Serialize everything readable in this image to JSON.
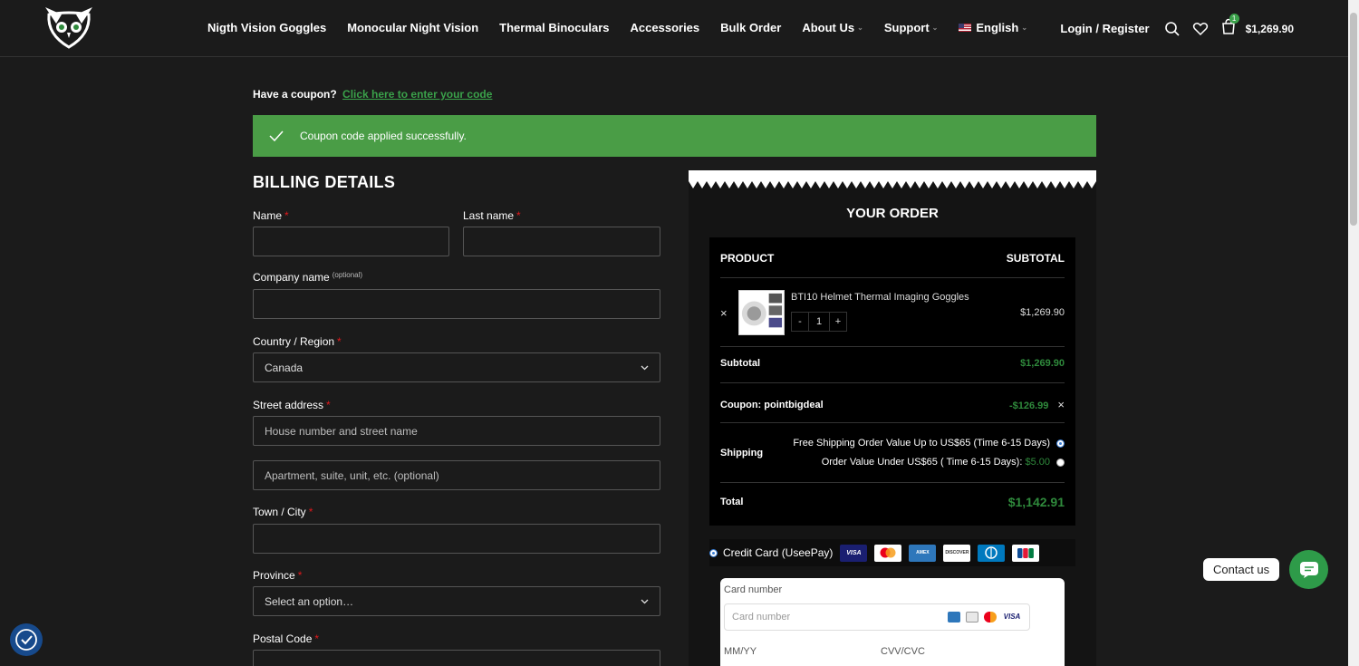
{
  "header": {
    "nav": [
      "Nigth Vision Goggles",
      "Monocular Night Vision",
      "Thermal Binoculars",
      "Accessories",
      "Bulk Order",
      "About Us",
      "Support",
      "English"
    ],
    "login": "Login / Register",
    "cart_count": "1",
    "cart_total": "$1,269.90"
  },
  "coupon": {
    "question": "Have a coupon?",
    "link": "Click here to enter your code",
    "notice": "Coupon code applied successfully."
  },
  "billing": {
    "title": "BILLING DETAILS",
    "name_label": "Name",
    "last_name_label": "Last name",
    "company_label": "Company name",
    "optional": "(optional)",
    "country_label": "Country / Region",
    "country_value": "Canada",
    "street_label": "Street address",
    "street_placeholder": "House number and street name",
    "apt_placeholder": "Apartment, suite, unit, etc. (optional)",
    "town_label": "Town / City",
    "province_label": "Province",
    "province_value": "Select an option…",
    "postal_label": "Postal Code",
    "required_mark": "*"
  },
  "order": {
    "title": "YOUR ORDER",
    "col_product": "PRODUCT",
    "col_subtotal": "SUBTOTAL",
    "product_name": "BTI10 Helmet Thermal Imaging Goggles",
    "qty": "1",
    "qty_minus": "-",
    "qty_plus": "+",
    "product_price": "$1,269.90",
    "remove": "×",
    "subtotal_label": "Subtotal",
    "subtotal_value": "$1,269.90",
    "coupon_label": "Coupon: pointbigdeal",
    "coupon_value": "-$126.99",
    "coupon_remove": "×",
    "shipping_label": "Shipping",
    "ship_option_1": "Free Shipping Order Value Up to US$65 (Time 6-15 Days)",
    "ship_option_2": "Order Value Under US$65 ( Time 6-15 Days):",
    "ship_option_2_price": "$5.00",
    "total_label": "Total",
    "total_value": "$1,142.91"
  },
  "payment": {
    "method": "Credit Card (UseePay)",
    "card_logos": [
      "VISA",
      "MC",
      "AMEX",
      "DISCOVER",
      "DINERS",
      "JCB"
    ],
    "card_number_label": "Card number",
    "card_number_placeholder": "Card number",
    "mmyy_label": "MM/YY",
    "cvv_label": "CVV/CVC"
  },
  "contact": "Contact us",
  "colors": {
    "accent": "#3aa14a",
    "notice_bg": "#4a9d46",
    "required": "#e0191c"
  }
}
